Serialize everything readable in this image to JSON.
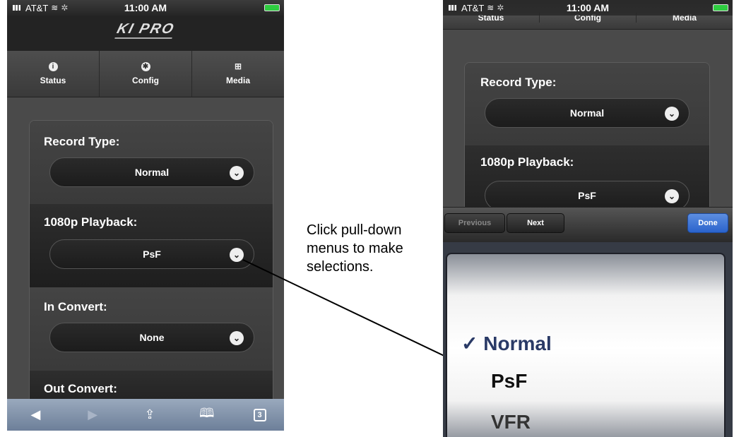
{
  "status": {
    "carrier": "AT&T",
    "time": "11:00 AM"
  },
  "app": {
    "logo": "KI PRO"
  },
  "tabs": [
    {
      "label": "Status",
      "icon": "info-icon"
    },
    {
      "label": "Config",
      "icon": "gear-icon"
    },
    {
      "label": "Media",
      "icon": "grid-icon"
    }
  ],
  "settings": [
    {
      "label": "Record Type:",
      "value": "Normal"
    },
    {
      "label": "1080p Playback:",
      "value": "PsF"
    },
    {
      "label": "In Convert:",
      "value": "None"
    },
    {
      "label": "Out Convert:",
      "value": ""
    }
  ],
  "toolbar": {
    "icons": [
      "back-arrow-icon",
      "forward-arrow-icon",
      "share-icon",
      "bookmarks-icon",
      "pages-icon"
    ],
    "pages_count": "3"
  },
  "accessory": {
    "previous": "Previous",
    "next": "Next",
    "done": "Done"
  },
  "picker": {
    "checkmark": "✓",
    "options": [
      "Normal",
      "PsF",
      "VFR"
    ],
    "selected": "Normal"
  },
  "callout": {
    "text": "Click pull-down menus to make selections."
  }
}
